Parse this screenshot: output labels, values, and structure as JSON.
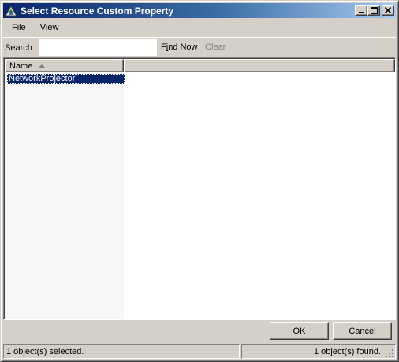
{
  "window": {
    "title": "Select Resource Custom Property",
    "controls": {
      "minimize": "_",
      "maximize": "□",
      "close": "×"
    }
  },
  "menu": {
    "items": [
      {
        "label": "File",
        "accel": "F",
        "rest": "ile"
      },
      {
        "label": "View",
        "accel": "V",
        "rest": "iew"
      }
    ]
  },
  "search": {
    "label": "Search:",
    "value": "",
    "placeholder": "",
    "find_now": {
      "pre": "F",
      "accel": "i",
      "rest": "nd Now"
    },
    "clear": "Clear"
  },
  "list": {
    "columns": [
      {
        "label": "Name",
        "sort": "ascending"
      },
      {
        "label": ""
      }
    ],
    "rows": [
      {
        "name": "NetworkProjector",
        "selected": true
      }
    ]
  },
  "buttons": {
    "ok": "OK",
    "cancel": "Cancel"
  },
  "status": {
    "left": "1 object(s) selected.",
    "right": "1 object(s) found."
  },
  "colors": {
    "titlebar_start": "#0a246a",
    "titlebar_end": "#a6caf0",
    "selection": "#0a246a",
    "face": "#d4d0c8"
  },
  "icons": [
    "app-icon",
    "sort-ascending-icon",
    "size-grip-icon"
  ]
}
